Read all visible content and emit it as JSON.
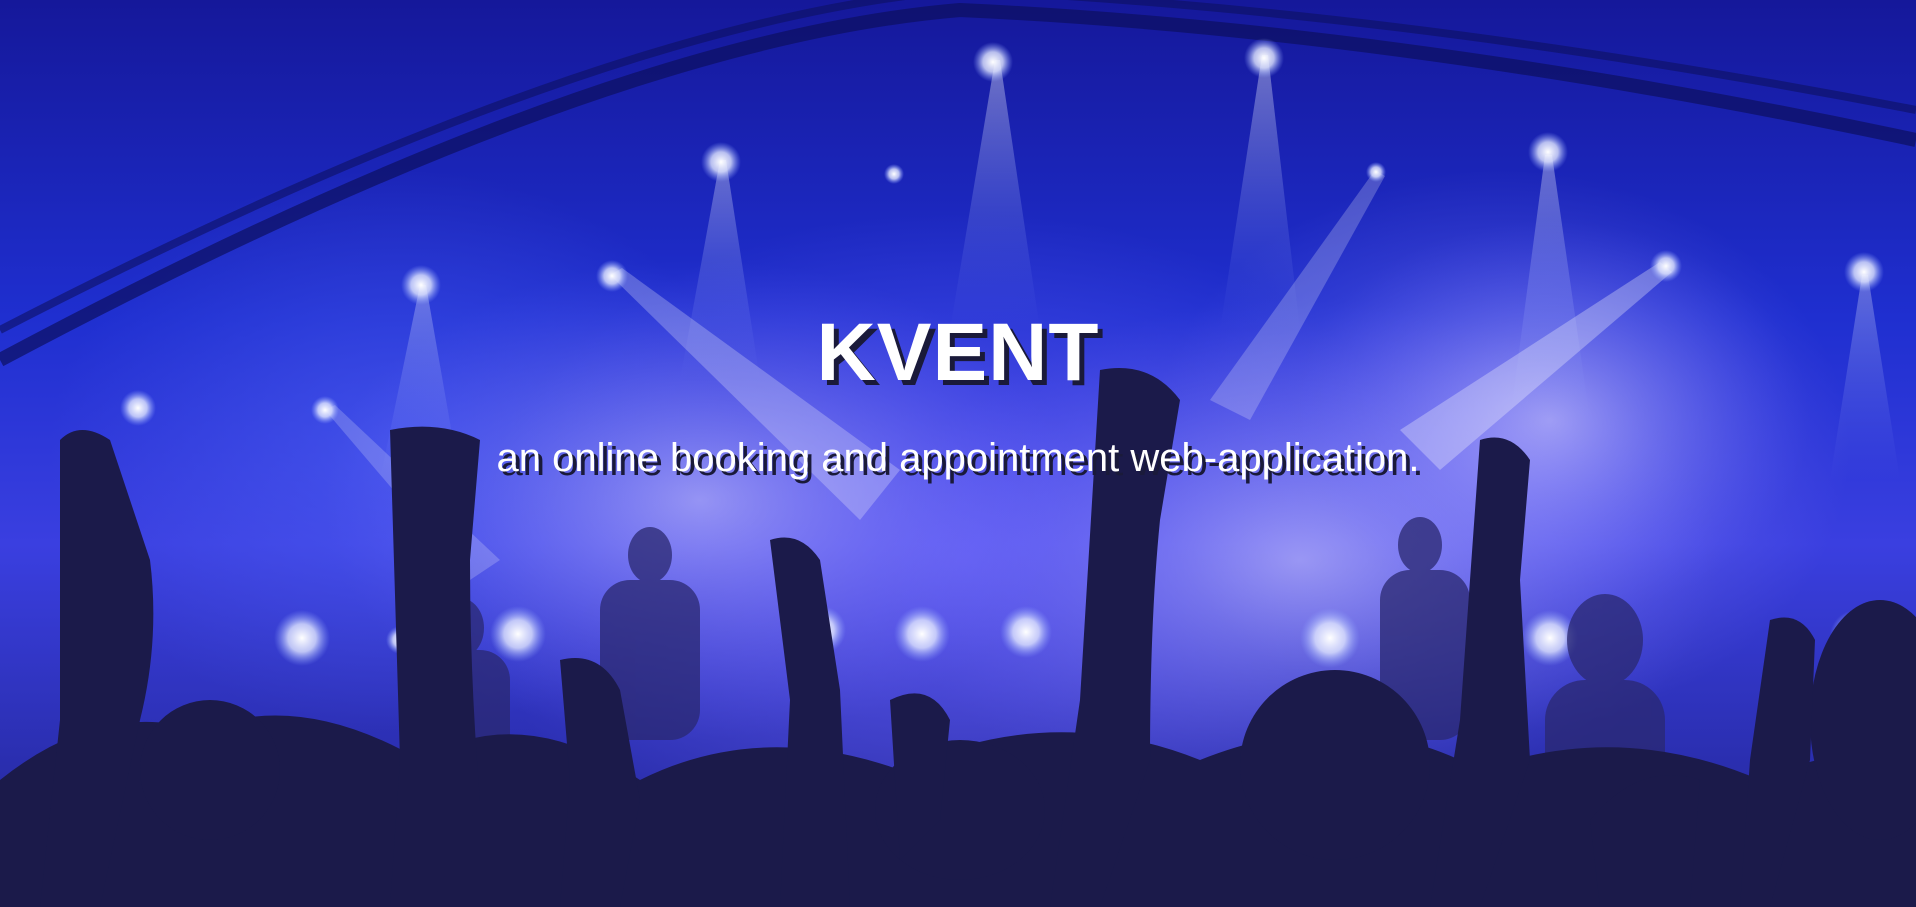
{
  "hero": {
    "title": "KVENT",
    "tagline": "an online booking and appointment web-application."
  },
  "colors": {
    "background_blue": "#1f2fd0",
    "light_white": "#ffffff",
    "silhouette": "#1b1a4a",
    "text": "#ffffff",
    "text_shadow": "#1a1a3a"
  }
}
